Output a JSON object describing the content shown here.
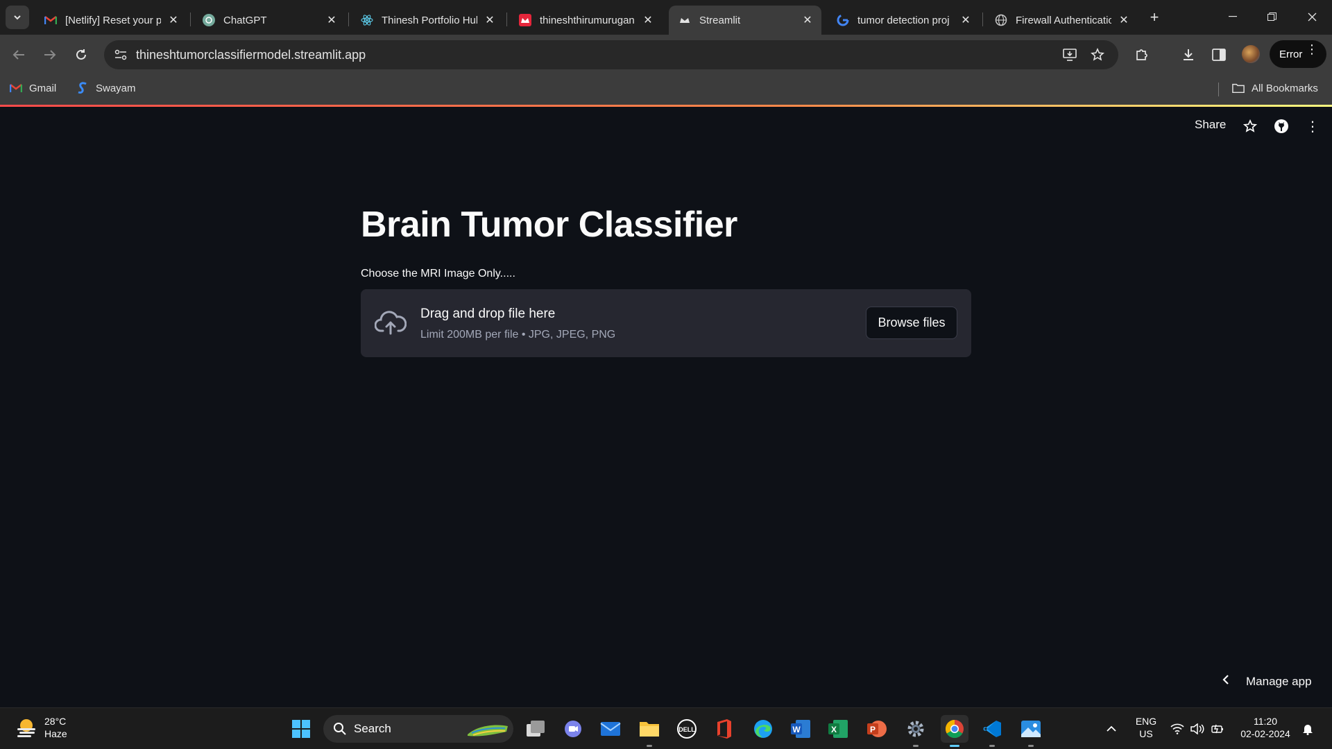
{
  "browser": {
    "tabs": [
      {
        "title": "[Netlify] Reset your p",
        "favicon": "gmail-icon"
      },
      {
        "title": "ChatGPT",
        "favicon": "chatgpt-icon"
      },
      {
        "title": "Thinesh Portfolio Hub",
        "favicon": "react-icon"
      },
      {
        "title": "thineshthirumurugan",
        "favicon": "streamlit-red-icon"
      },
      {
        "title": "Streamlit",
        "favicon": "streamlit-crown-icon",
        "active": true
      },
      {
        "title": "tumor detection proj",
        "favicon": "google-icon"
      },
      {
        "title": "Firewall Authenticatio",
        "favicon": "globe-icon"
      }
    ],
    "address": "thineshtumorclassifiermodel.streamlit.app",
    "profile_button": "Error",
    "bookmarks": [
      {
        "label": "Gmail",
        "icon": "gmail-icon"
      },
      {
        "label": "Swayam",
        "icon": "swayam-icon"
      }
    ],
    "all_bookmarks": "All Bookmarks"
  },
  "streamlit": {
    "header": {
      "share": "Share"
    },
    "title": "Brain Tumor Classifier",
    "uploader": {
      "label": "Choose the MRI Image Only.....",
      "drop_title": "Drag and drop file here",
      "drop_subtitle": "Limit 200MB per file • JPG, JPEG, PNG",
      "browse_button": "Browse files"
    },
    "manage_app": "Manage app"
  },
  "taskbar": {
    "weather": {
      "temp": "28°C",
      "condition": "Haze"
    },
    "search_placeholder": "Search",
    "language": {
      "line1": "ENG",
      "line2": "US"
    },
    "clock": {
      "time": "11:20",
      "date": "02-02-2024"
    }
  },
  "colors": {
    "page_bg": "#0e1117",
    "uploader_bg": "#262730",
    "accent_gradient_start": "#ff4b4b",
    "accent_gradient_end": "#fffd80"
  }
}
